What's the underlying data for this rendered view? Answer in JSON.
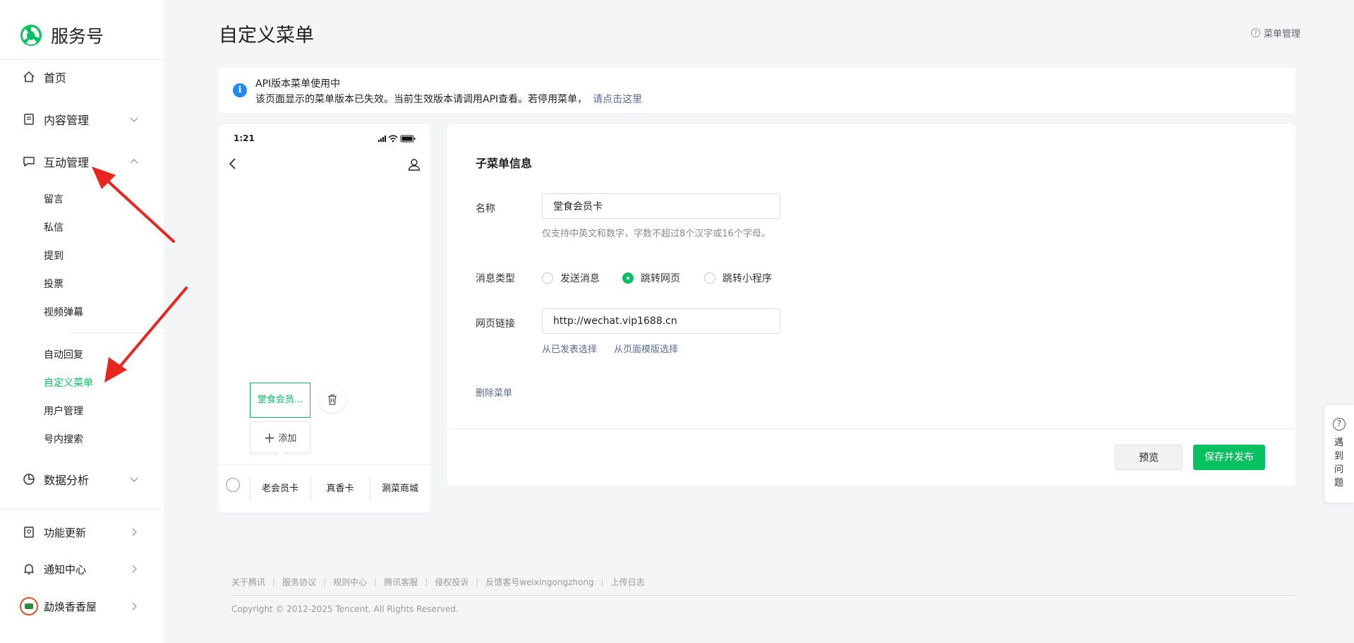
{
  "sidebar": {
    "brand": "服务号",
    "home": "首页",
    "content_mgmt": "内容管理",
    "interaction_mgmt": "互动管理",
    "interaction_items": [
      "留言",
      "私信",
      "提到",
      "投票",
      "视频弹幕"
    ],
    "service_items": [
      "自动回复",
      "自定义菜单",
      "用户管理",
      "号内搜索"
    ],
    "data_analysis": "数据分析",
    "feature_update": "功能更新",
    "notification_center": "通知中心",
    "account_name": "勐焕香香屋"
  },
  "header": {
    "title": "自定义菜单",
    "help_link": "菜单管理"
  },
  "notice": {
    "title": "API版本菜单使用中",
    "message": "该页面显示的菜单版本已失效。当前生效版本请调用API查看。若停用菜单，",
    "link": "请点击这里"
  },
  "phone": {
    "time": "1:21",
    "sub_menu_item": "堂食会员...",
    "add_label": "添加",
    "tabs": [
      "老会员卡",
      "真香卡",
      "涮菜商城"
    ]
  },
  "form": {
    "section_title": "子菜单信息",
    "name_label": "名称",
    "name_value": "堂食会员卡",
    "name_hint": "仅支持中英文和数字，字数不超过8个汉字或16个字母。",
    "msg_type_label": "消息类型",
    "msg_types": [
      "发送消息",
      "跳转网页",
      "跳转小程序"
    ],
    "msg_type_selected": "跳转网页",
    "url_label": "网页链接",
    "url_value": "http://wechat.vip1688.cn",
    "select_published": "从已发表选择",
    "select_template": "从页面模版选择",
    "delete_menu": "删除菜单",
    "preview_btn": "预览",
    "publish_btn": "保存并发布"
  },
  "footer": {
    "links": [
      "关于腾讯",
      "服务协议",
      "规则中心",
      "腾讯客服",
      "侵权投诉",
      "反馈客号weixingongzhong",
      "上传日志"
    ],
    "copyright": "Copyright © 2012-2025 Tencent. All Rights Reserved."
  },
  "float_help": "遇到问题",
  "colors": {
    "accent": "#07c160",
    "link": "#576b95",
    "info": "#1f8bf0",
    "arrow": "#e8261f"
  }
}
